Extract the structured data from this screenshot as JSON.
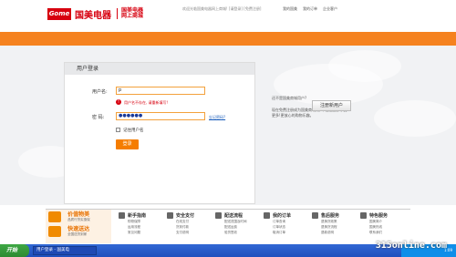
{
  "header": {
    "logo_text": "Gome",
    "logo_cn": "国美电器",
    "logo_sub1": "国美电器",
    "logo_sub2": "网上商城",
    "welcome": "欢迎光临国美电器网上商城! [请登录] [免费注册]",
    "links": [
      "我的国美",
      "我的订单",
      "企业客户"
    ]
  },
  "login": {
    "title": "用户登录",
    "username_label": "用户名:",
    "username_value": "p",
    "error_text": "用户名不存在, 请重新填写!",
    "password_label": "密  码:",
    "password_value": "●●●●●●",
    "forgot_link": "忘记密码?",
    "remember_label": "记住用户名",
    "submit_label": "登录"
  },
  "register": {
    "line1": "还不是国美商城用户?",
    "line2": "现在免费注册成为国美商城用户, 便能立即享受",
    "line3": "更多!更放心的购物乐趣。",
    "button": "注册新用户"
  },
  "footer": {
    "promo1_title": "价值物美",
    "promo1_sub": "品质行货实惠保",
    "promo2_title": "快速送达",
    "promo2_sub": "全国送货到家",
    "columns": [
      {
        "title": "新手指南",
        "items": [
          "购物保障",
          "运用流程",
          "常见问题"
        ]
      },
      {
        "title": "安全支付",
        "items": [
          "在线支付",
          "货到付款",
          "支付说明"
        ]
      },
      {
        "title": "配送流程",
        "items": [
          "配送范围及时间",
          "配送运费",
          "验货签收"
        ]
      },
      {
        "title": "我的订单",
        "items": [
          "订单查询",
          "订单状态",
          "取消订单"
        ]
      },
      {
        "title": "售后服务",
        "items": [
          "退换货政策",
          "退换货流程",
          "退款说明"
        ]
      },
      {
        "title": "特色服务",
        "items": [
          "国美简介",
          "国美热线",
          "联系我们"
        ]
      }
    ]
  },
  "taskbar": {
    "start": "开始",
    "task": "用户登录 - 国美电",
    "clock": "1:09"
  },
  "watermark": "315online.com"
}
